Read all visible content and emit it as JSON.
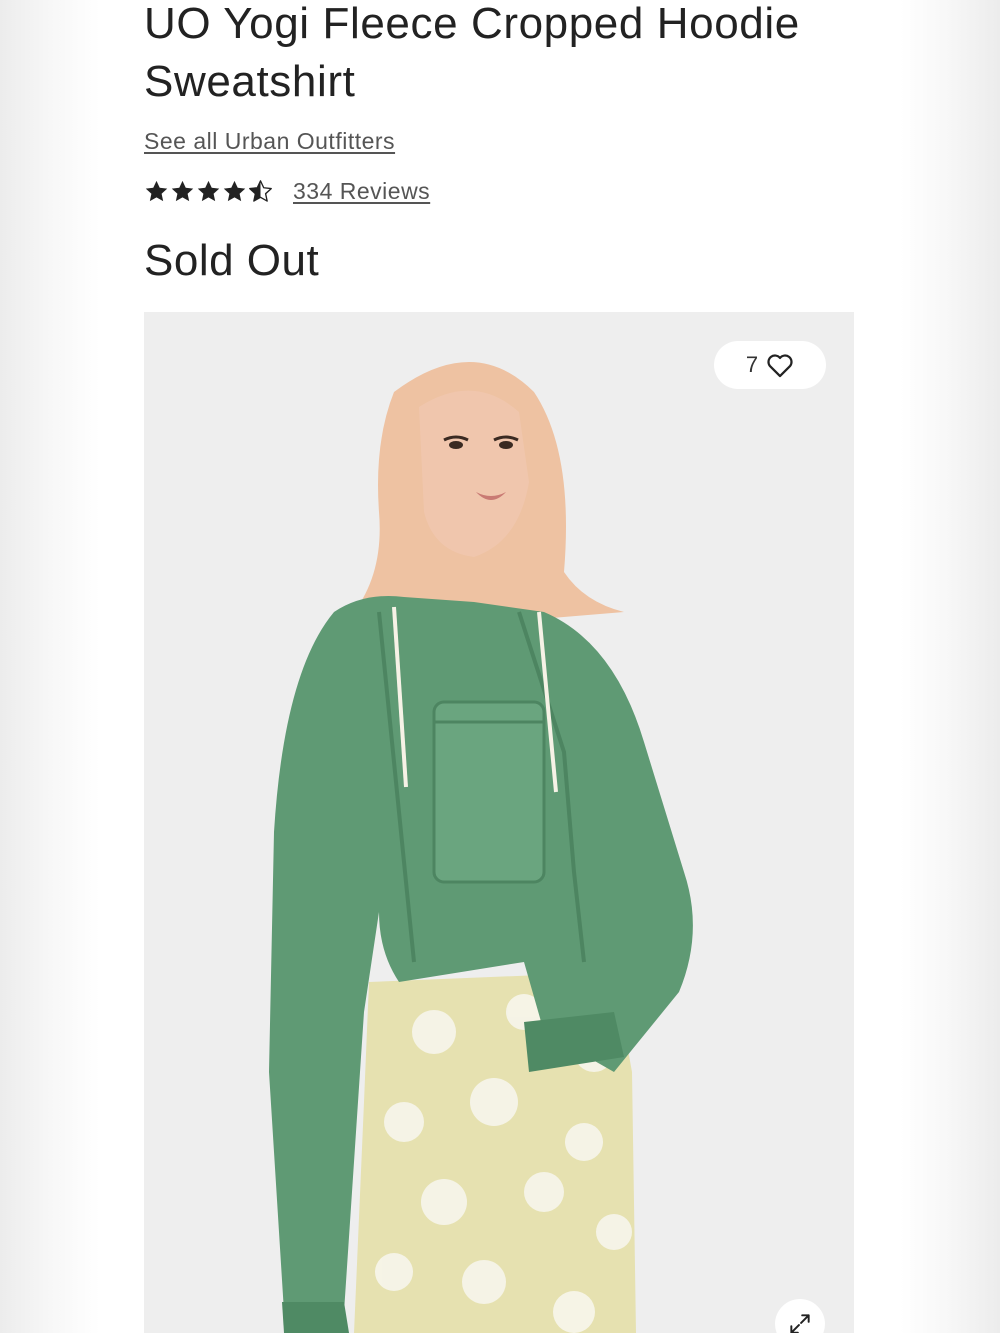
{
  "product": {
    "title": "UO Yogi Fleece Cropped Hoodie Sweatshirt",
    "brand_link": "See all Urban Outfitters",
    "rating": 4.5,
    "rating_max": 5,
    "reviews_link": "334 Reviews",
    "price_status": "Sold Out"
  },
  "gallery": {
    "favorites_count": "7",
    "favorite_icon": "heart-outline-icon",
    "expand_icon": "expand-arrows-icon",
    "image_alt": "Model wearing green cropped hoodie sweatshirt and floral pants"
  },
  "colors": {
    "text": "#222222",
    "link": "#555555",
    "hoodie": "#5f9a74",
    "image_bg": "#eeeeee"
  }
}
